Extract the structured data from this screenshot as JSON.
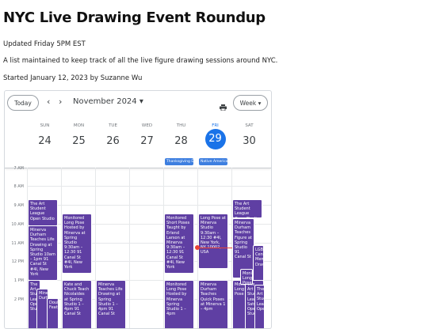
{
  "page": {
    "title": "NYC Live Drawing Event Roundup",
    "updated": "Updated Friday 5PM EST",
    "description": "A list maintained to keep track of all the live figure drawing sessions around NYC.",
    "started": "Started January 12, 2023 by Suzanne Wu"
  },
  "calendar": {
    "today_label": "Today",
    "prev_icon": "chevron-left-icon",
    "next_icon": "chevron-right-icon",
    "month_label": "November 2024 ▾",
    "print_icon": "print-icon",
    "view_label": "Week ▾",
    "days": [
      {
        "name": "SUN",
        "num": "24"
      },
      {
        "name": "MON",
        "num": "25"
      },
      {
        "name": "TUE",
        "num": "26"
      },
      {
        "name": "WED",
        "num": "27"
      },
      {
        "name": "THU",
        "num": "28"
      },
      {
        "name": "FRI",
        "num": "29"
      },
      {
        "name": "SAT",
        "num": "30"
      }
    ],
    "all_day": [
      {
        "day": "THU",
        "label": "Thanksgiving D"
      },
      {
        "day": "FRI",
        "label": "Native America"
      }
    ],
    "times": [
      "7 AM",
      "8 AM",
      "9 AM",
      "10 AM",
      "11 AM",
      "12 PM",
      "1 PM",
      "2 PM"
    ],
    "events": [
      {
        "text": "The Art Student League Open Studio"
      },
      {
        "text": "Minerva Durham Teaches Life Drawing at Spring Studio 10am – 1pm 91 Canal St #4I, New York"
      },
      {
        "text": "Monitored Long Pose Hosted by Minerva at Spring Studio 9:30am – 12:30 91 Canal St #4I, New York"
      },
      {
        "text": "Monitored Short Poses Taught by Erlend Larson at Minerva 9:30am – 12:30 91 Canal St #4I, New York"
      },
      {
        "text": "Long Pose at Minerva Studio 9:30am – 12:30 #4I, New York, NY 10002, USA"
      },
      {
        "text": "The Art Student League Open Studio"
      },
      {
        "text": "Minerva Durham Teaches Figure at Spring Studio 91 Canal St"
      },
      {
        "text": "LGBTQ Center Member Drawing"
      },
      {
        "text": "Kate and Chuck Teach Nicolaides at Spring Studio 1 – 4pm 91 Canal St"
      },
      {
        "text": "Minerva Teaches Life Drawing at Spring Studio 1 – 4pm 91 Canal St"
      },
      {
        "text": "Monitored Long Pose Hosted by Minerva Spring Studio 1 – 4pm"
      },
      {
        "text": "Minerva Durham Teaches Quick Poses at Minerva 1 – 4pm"
      },
      {
        "text": "Monitored Long Pose"
      },
      {
        "text": "The Art Student League Saturday Open Studio"
      },
      {
        "text": "The Art Student League Open Studio"
      },
      {
        "text": "Minerva Durham"
      },
      {
        "text": "Double Feature"
      },
      {
        "text": "Monitored Long Pose"
      },
      {
        "text": "The Art Student League Open"
      }
    ]
  }
}
